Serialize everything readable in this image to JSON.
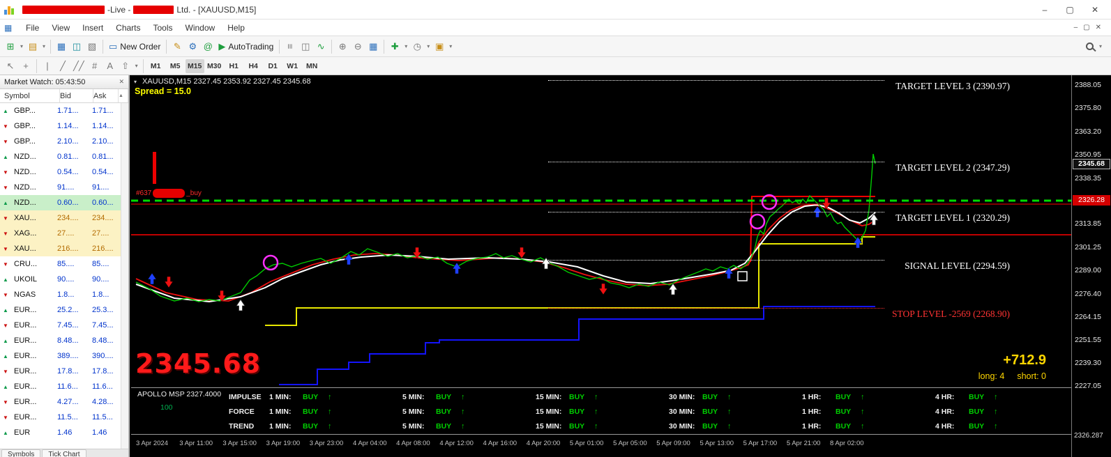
{
  "window": {
    "title_live": "-Live -",
    "title_company": "Ltd. - [XAUUSD,M15]"
  },
  "icons": {
    "caret": "▾",
    "new_chart": "⊞",
    "profiles": "▤",
    "market_watch": "▦",
    "data_window": "◫",
    "navigator": "▧",
    "new_order": "▭",
    "metaeditor": "✎",
    "options": "⚙",
    "at": "@",
    "autotrading_play": "▶",
    "chart_bars": "≡",
    "chart_candles": "◫",
    "chart_line": "∿",
    "zoom_in": "⊕",
    "zoom_out": "⊖",
    "tile": "▦",
    "indicators": "✚",
    "periods": "◷",
    "templates": "▣",
    "cursor": "↖",
    "crosshair": "+",
    "vline": "|",
    "trendline": "╱",
    "channel": "╱╱",
    "grid": "#",
    "text_tool": "A",
    "arrows_tool": "⇧",
    "minimize": "–",
    "maximize": "▢",
    "close": "✕",
    "mw_close": "✕",
    "scroll_up": "▲",
    "symbol_collapse": "▾",
    "doc": "▦"
  },
  "menu": {
    "items": [
      "File",
      "View",
      "Insert",
      "Charts",
      "Tools",
      "Window",
      "Help"
    ]
  },
  "toolbar": {
    "new_order_label": "New Order",
    "autotrading_label": "AutoTrading"
  },
  "timeframes": [
    {
      "label": "M1"
    },
    {
      "label": "M5"
    },
    {
      "label": "M15",
      "bg": "#d6d6d6"
    },
    {
      "label": "M30"
    },
    {
      "label": "H1"
    },
    {
      "label": "H4"
    },
    {
      "label": "D1"
    },
    {
      "label": "W1"
    },
    {
      "label": "MN"
    }
  ],
  "market_watch": {
    "title": "Market Watch: 05:43:50",
    "col_symbol": "Symbol",
    "col_bid": "Bid",
    "col_ask": "Ask",
    "rows": [
      {
        "symbol": "GBP...",
        "bid": "1.71...",
        "ask": "1.71...",
        "arrow": "▲",
        "ac": "#0a9a4a"
      },
      {
        "symbol": "GBP...",
        "bid": "1.14...",
        "ask": "1.14...",
        "arrow": "▼",
        "ac": "#cc1111"
      },
      {
        "symbol": "GBP...",
        "bid": "2.10...",
        "ask": "2.10...",
        "arrow": "▼",
        "ac": "#cc1111"
      },
      {
        "symbol": "NZD...",
        "bid": "0.81...",
        "ask": "0.81...",
        "arrow": "▲",
        "ac": "#0a9a4a"
      },
      {
        "symbol": "NZD...",
        "bid": "0.54...",
        "ask": "0.54...",
        "arrow": "▼",
        "ac": "#cc1111"
      },
      {
        "symbol": "NZD...",
        "bid": "91....",
        "ask": "91....",
        "arrow": "▼",
        "ac": "#cc1111"
      },
      {
        "symbol": "NZD...",
        "bid": "0.60...",
        "ask": "0.60...",
        "arrow": "▲",
        "ac": "#0a9a4a",
        "bg": "#c9efc9"
      },
      {
        "symbol": "XAU...",
        "bid": "234....",
        "ask": "234....",
        "arrow": "▼",
        "ac": "#cc1111",
        "bg": "#fcf2c4",
        "vc": "#b36b00"
      },
      {
        "symbol": "XAG...",
        "bid": "27....",
        "ask": "27....",
        "arrow": "▼",
        "ac": "#cc1111",
        "bg": "#fcf2c4",
        "vc": "#b36b00"
      },
      {
        "symbol": "XAU...",
        "bid": "216....",
        "ask": "216....",
        "arrow": "▼",
        "ac": "#cc1111",
        "bg": "#fcf2c4",
        "vc": "#b36b00"
      },
      {
        "symbol": "CRU...",
        "bid": "85....",
        "ask": "85....",
        "arrow": "▼",
        "ac": "#cc1111"
      },
      {
        "symbol": "UKOIL",
        "bid": "90....",
        "ask": "90....",
        "arrow": "▲",
        "ac": "#0a9a4a"
      },
      {
        "symbol": "NGAS",
        "bid": "1.8...",
        "ask": "1.8...",
        "arrow": "▼",
        "ac": "#cc1111"
      },
      {
        "symbol": "EUR...",
        "bid": "25.2...",
        "ask": "25.3...",
        "arrow": "▲",
        "ac": "#0a9a4a"
      },
      {
        "symbol": "EUR...",
        "bid": "7.45...",
        "ask": "7.45...",
        "arrow": "▼",
        "ac": "#cc1111"
      },
      {
        "symbol": "EUR...",
        "bid": "8.48...",
        "ask": "8.48...",
        "arrow": "▲",
        "ac": "#0a9a4a"
      },
      {
        "symbol": "EUR...",
        "bid": "389....",
        "ask": "390....",
        "arrow": "▲",
        "ac": "#0a9a4a"
      },
      {
        "symbol": "EUR...",
        "bid": "17.8...",
        "ask": "17.8...",
        "arrow": "▼",
        "ac": "#cc1111"
      },
      {
        "symbol": "EUR...",
        "bid": "11.6...",
        "ask": "11.6...",
        "arrow": "▲",
        "ac": "#0a9a4a"
      },
      {
        "symbol": "EUR...",
        "bid": "4.27...",
        "ask": "4.28...",
        "arrow": "▼",
        "ac": "#cc1111"
      },
      {
        "symbol": "EUR...",
        "bid": "11.5...",
        "ask": "11.5...",
        "arrow": "▼",
        "ac": "#cc1111"
      },
      {
        "symbol": "EUR",
        "bid": "1.46",
        "ask": "1.46",
        "arrow": "▲",
        "ac": "#0a9a4a"
      }
    ],
    "tab_symbols": "Symbols",
    "tab_tick": "Tick Chart"
  },
  "chart": {
    "header": "XAUUSD,M15 2327.45 2353.92 2327.45 2345.68",
    "spread": "Spread = 15.0",
    "order_prefix": "#637",
    "order_suffix": "_buy",
    "big_price": "2345.68",
    "profit": "+712.9",
    "long_label": "long: 4",
    "short_label": "short: 0",
    "levels": [
      {
        "label": "TARGET LEVEL 3 (2390.97)",
        "value": 2390.97,
        "color": "#ffffff"
      },
      {
        "label": "TARGET LEVEL 2 (2347.29)",
        "value": 2347.29,
        "color": "#ffffff"
      },
      {
        "label": "TARGET LEVEL 1 (2320.29)",
        "value": 2320.29,
        "color": "#ffffff"
      },
      {
        "label": "SIGNAL LEVEL (2294.59)",
        "value": 2294.59,
        "color": "#ffffff"
      },
      {
        "label": "STOP LEVEL -2569 (2268.90)",
        "value": 2268.9,
        "color": "#ff3333"
      }
    ],
    "scale": {
      "ticks": [
        {
          "v": "2388.05"
        },
        {
          "v": "2375.80"
        },
        {
          "v": "2363.20"
        },
        {
          "v": "2350.95"
        },
        {
          "v": "2338.35"
        },
        {
          "v": "2313.85"
        },
        {
          "v": "2301.25"
        },
        {
          "v": "2289.00"
        },
        {
          "v": "2276.40"
        },
        {
          "v": "2264.15"
        },
        {
          "v": "2251.55"
        },
        {
          "v": "2239.30"
        },
        {
          "v": "2227.05"
        }
      ],
      "price_box": {
        "text": "2345.68",
        "value": 2345.68
      },
      "alert_box": {
        "text": "2326.28",
        "value": 2326.28
      },
      "bottom_readout": "2326.287"
    },
    "time_axis": [
      "3 Apr 2024",
      "3 Apr 11:00",
      "3 Apr 15:00",
      "3 Apr 19:00",
      "3 Apr 23:00",
      "4 Apr 04:00",
      "4 Apr 08:00",
      "4 Apr 12:00",
      "4 Apr 16:00",
      "4 Apr 20:00",
      "5 Apr 01:00",
      "5 Apr 05:00",
      "5 Apr 09:00",
      "5 Apr 13:00",
      "5 Apr 17:00",
      "5 Apr 21:00",
      "8 Apr 02:00"
    ]
  },
  "indicator_panel": {
    "name": "APOLLO MSP 2327.4000",
    "level": "100",
    "rows": [
      "IMPULSE",
      "FORCE",
      "TREND"
    ],
    "cells": [
      {
        "tf": "1 MIN:",
        "sig": "BUY",
        "arr": "↑"
      },
      {
        "tf": "5 MIN:",
        "sig": "BUY",
        "arr": "↑"
      },
      {
        "tf": "15 MIN:",
        "sig": "BUY",
        "arr": "↑"
      },
      {
        "tf": "30 MIN:",
        "sig": "BUY",
        "arr": "↑"
      },
      {
        "tf": "1 HR:",
        "sig": "BUY",
        "arr": "↑"
      },
      {
        "tf": "4 HR:",
        "sig": "BUY",
        "arr": "↑"
      }
    ]
  }
}
